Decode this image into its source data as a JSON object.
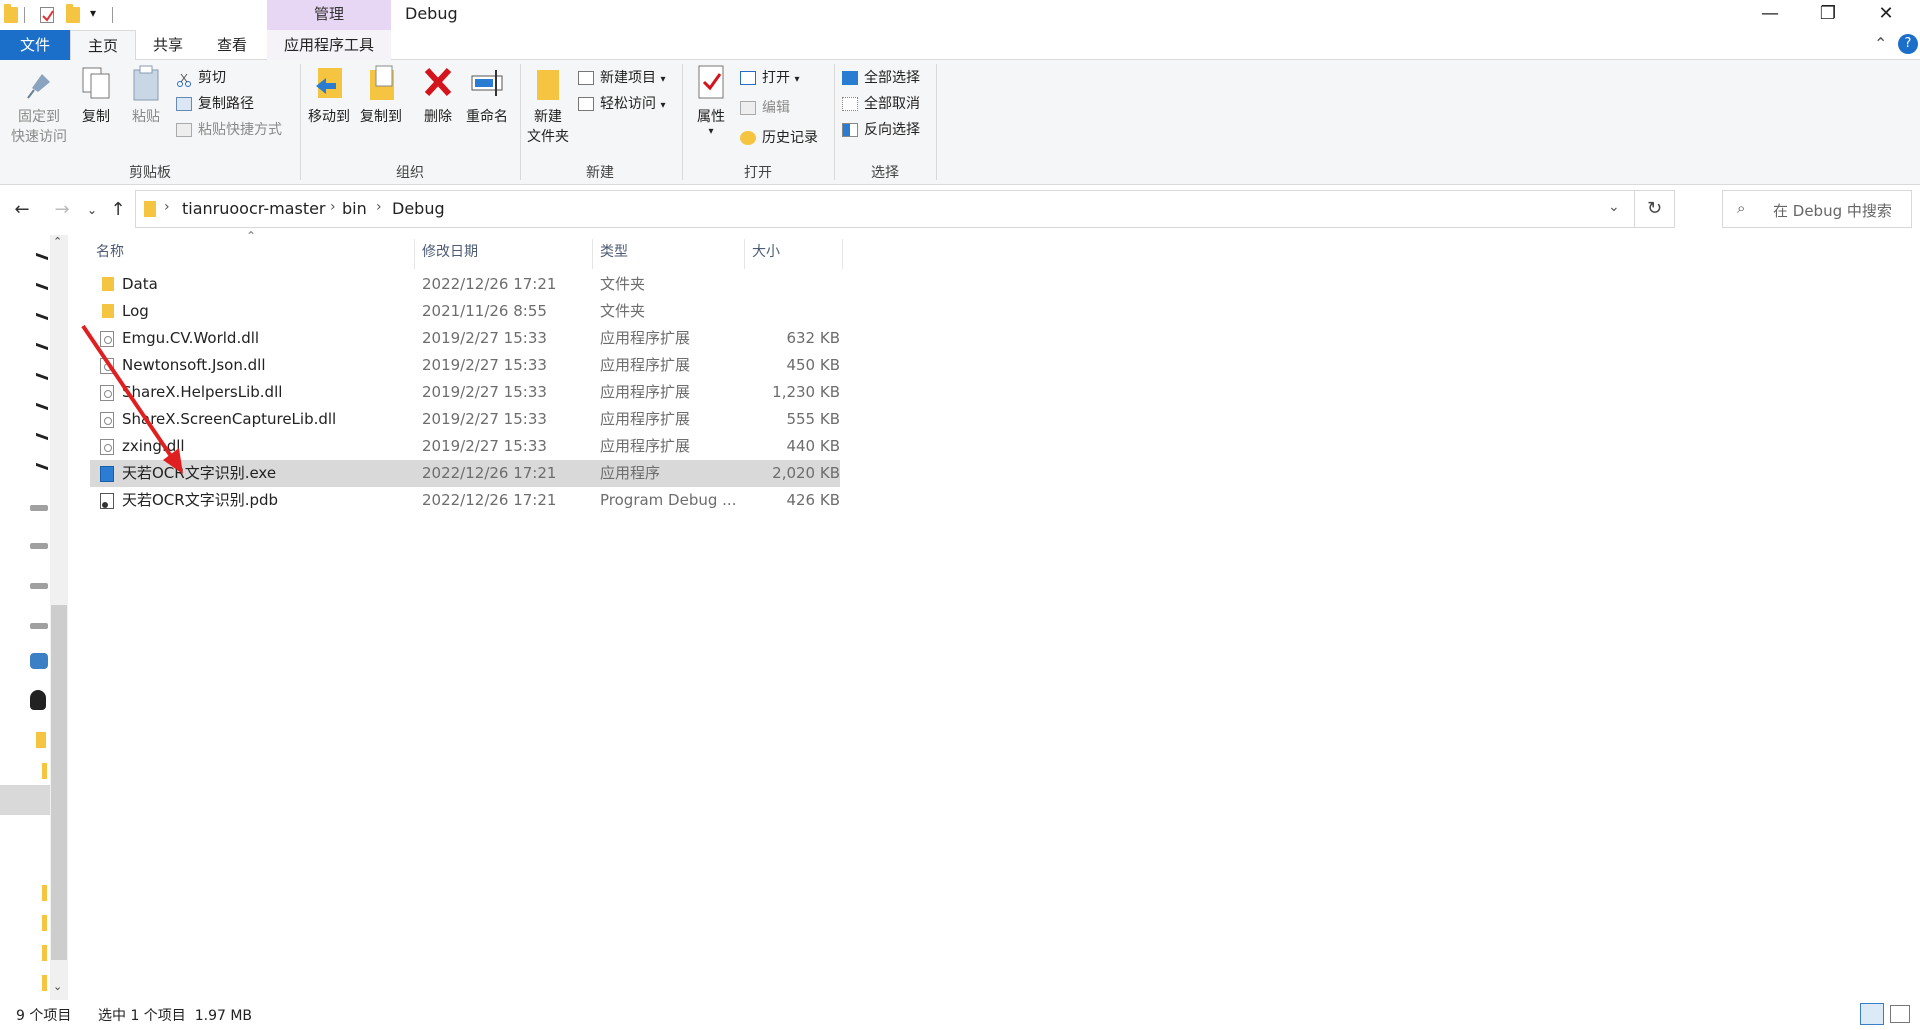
{
  "window": {
    "title": "Debug",
    "manage_tab": "管理",
    "minimize": "—",
    "maximize": "❐",
    "close": "✕"
  },
  "ribbon_tabs": {
    "file": "文件",
    "home": "主页",
    "share": "共享",
    "view": "查看",
    "app_tools": "应用程序工具"
  },
  "ribbon": {
    "clipboard": {
      "label": "剪贴板",
      "pin_line1": "固定到",
      "pin_line2": "快速访问",
      "copy": "复制",
      "paste": "粘贴",
      "cut": "剪切",
      "copy_path": "复制路径",
      "paste_shortcut": "粘贴快捷方式"
    },
    "organize": {
      "label": "组织",
      "move_to": "移动到",
      "copy_to": "复制到",
      "delete": "删除",
      "rename": "重命名"
    },
    "new": {
      "label": "新建",
      "new_folder_line1": "新建",
      "new_folder_line2": "文件夹",
      "new_item": "新建项目",
      "easy_access": "轻松访问"
    },
    "open": {
      "label": "打开",
      "properties": "属性",
      "open": "打开",
      "edit": "编辑",
      "history": "历史记录"
    },
    "select": {
      "label": "选择",
      "select_all": "全部选择",
      "select_none": "全部取消",
      "invert": "反向选择"
    }
  },
  "address": {
    "crumbs": [
      "tianruoocr-master",
      "bin",
      "Debug"
    ],
    "search_placeholder": "在 Debug 中搜索"
  },
  "columns": {
    "name": "名称",
    "modified": "修改日期",
    "type": "类型",
    "size": "大小"
  },
  "files": [
    {
      "name": "Data",
      "modified": "2022/12/26 17:21",
      "type": "文件夹",
      "size": "",
      "kind": "folder"
    },
    {
      "name": "Log",
      "modified": "2021/11/26 8:55",
      "type": "文件夹",
      "size": "",
      "kind": "folder"
    },
    {
      "name": "Emgu.CV.World.dll",
      "modified": "2019/2/27 15:33",
      "type": "应用程序扩展",
      "size": "632 KB",
      "kind": "dll"
    },
    {
      "name": "Newtonsoft.Json.dll",
      "modified": "2019/2/27 15:33",
      "type": "应用程序扩展",
      "size": "450 KB",
      "kind": "dll"
    },
    {
      "name": "ShareX.HelpersLib.dll",
      "modified": "2019/2/27 15:33",
      "type": "应用程序扩展",
      "size": "1,230 KB",
      "kind": "dll"
    },
    {
      "name": "ShareX.ScreenCaptureLib.dll",
      "modified": "2019/2/27 15:33",
      "type": "应用程序扩展",
      "size": "555 KB",
      "kind": "dll"
    },
    {
      "name": "zxing.dll",
      "modified": "2019/2/27 15:33",
      "type": "应用程序扩展",
      "size": "440 KB",
      "kind": "dll"
    },
    {
      "name": "天若OCR文字识别.exe",
      "modified": "2022/12/26 17:21",
      "type": "应用程序",
      "size": "2,020 KB",
      "kind": "exe",
      "selected": true
    },
    {
      "name": "天若OCR文字识别.pdb",
      "modified": "2022/12/26 17:21",
      "type": "Program Debug ...",
      "size": "426 KB",
      "kind": "pdb"
    }
  ],
  "status": {
    "count": "9 个项目",
    "selection": "选中 1 个项目  1.97 MB"
  },
  "colors": {
    "accent": "#1c6fc9",
    "manage_tab": "#e8d6f5",
    "selected_row": "#d9d9d9",
    "arrow": "#e02020"
  }
}
